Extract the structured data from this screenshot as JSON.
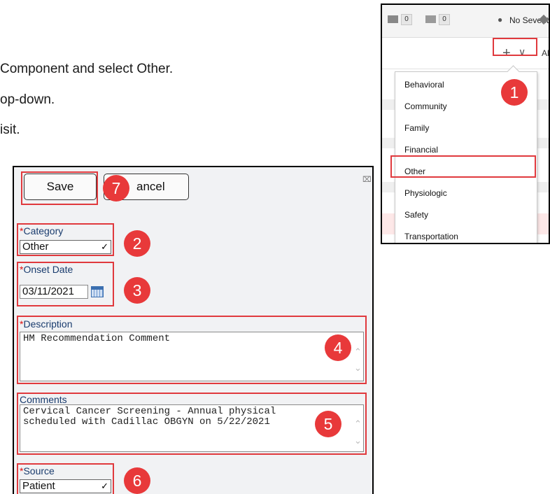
{
  "instructions": [
    "Component and select Other.",
    "op-down.",
    "isit."
  ],
  "steps": [
    "1",
    "2",
    "3",
    "4",
    "5",
    "6",
    "7"
  ],
  "toolbar": {
    "count_a": "0",
    "count_b": "0",
    "severity": "No Severity",
    "all_fragment": "Al"
  },
  "menu": {
    "items": [
      "Behavioral",
      "Community",
      "Family",
      "Financial",
      "Other",
      "Physiologic",
      "Safety",
      "Transportation"
    ],
    "selected": "Other"
  },
  "dialog": {
    "save_label": "Save",
    "cancel_label": "ancel",
    "category_label": "Category",
    "category_value": "Other",
    "onset_label": "Onset Date",
    "onset_value": "03/11/2021",
    "description_label": "Description",
    "description_value": "HM Recommendation Comment",
    "comments_label": "Comments",
    "comments_line1": "Cervical Cancer Screening - Annual physical",
    "comments_line2": "scheduled with Cadillac OBGYN on 5/22/2021",
    "source_label": "Source",
    "source_value": "Patient",
    "required_mark": "*"
  },
  "colors": {
    "highlight": "#e0393d",
    "badge": "#e8393a",
    "dialog_bg": "#f1f2f4",
    "label_text": "#1a3c6e"
  },
  "icons": [
    "message-icon",
    "inbox-icon",
    "person-icon",
    "tag-icon",
    "plus-icon",
    "chevron-down-icon",
    "calendar-icon",
    "close-icon"
  ]
}
